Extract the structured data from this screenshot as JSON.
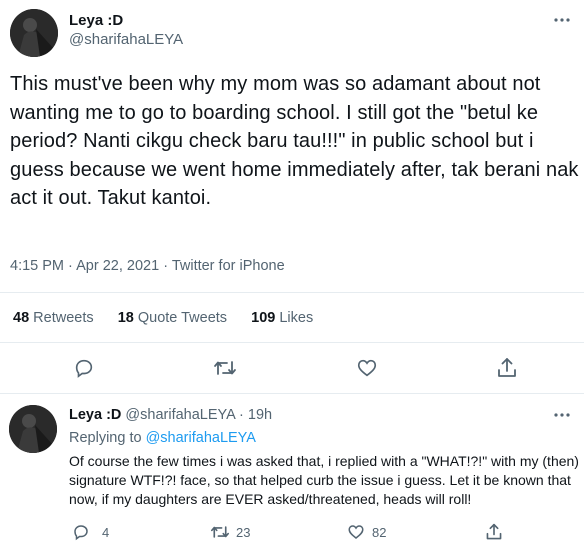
{
  "tweet": {
    "author_name": "Leya :D",
    "author_handle": "@sharifahaLEYA",
    "more_icon": "more-dots-icon",
    "text": "This must've been why my mom was so adamant about not wanting me to go to boarding school. I still got the \"betul ke period? Nanti cikgu check baru tau!!!\" in public school but i guess because we went home immediately after, tak berani nak act it out. Takut kantoi.",
    "time": "4:15 PM",
    "date": "Apr 22, 2021",
    "source": "Twitter for iPhone",
    "stats": {
      "retweets_count": "48",
      "retweets_label": "Retweets",
      "quotes_count": "18",
      "quotes_label": "Quote Tweets",
      "likes_count": "109",
      "likes_label": "Likes"
    },
    "actions": [
      "reply-icon",
      "retweet-icon",
      "like-icon",
      "share-icon"
    ]
  },
  "reply": {
    "author_name": "Leya :D",
    "author_handle": "@sharifahaLEYA",
    "time_ago": "19h",
    "replying_to_label": "Replying to",
    "replying_to_handle": "@sharifahaLEYA",
    "text": "Of course the few times i was asked that, i replied with a \"WHAT!?!\" with my (then) signature WTF!?! face, so that helped curb the issue i guess. Let it be known that now, if my daughters are EVER asked/threatened, heads will roll!",
    "replies": "4",
    "retweets": "23",
    "likes": "82"
  },
  "colors": {
    "accent": "#1d9bf0",
    "muted": "#536471",
    "divider": "#e6ecf0",
    "text": "#0f1419"
  }
}
